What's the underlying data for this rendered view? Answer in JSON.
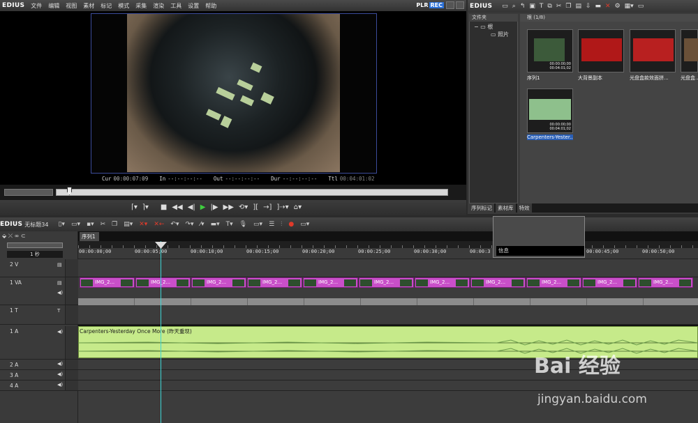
{
  "app": {
    "logo": "EDIUS",
    "plr": "PLR",
    "rec": "REC"
  },
  "menu": [
    "文件",
    "编辑",
    "视图",
    "素材",
    "标记",
    "模式",
    "采集",
    "渲染",
    "工具",
    "设置",
    "帮助"
  ],
  "preview": {
    "cur_label": "Cur",
    "cur": "00:00:07:09",
    "in_label": "In",
    "in": "--:--:--:--",
    "out_label": "Out",
    "out": "--:--:--:--",
    "dur_label": "Dur",
    "dur": "--:--:--:--",
    "ttl_label": "Ttl",
    "ttl": "00:04:01:02"
  },
  "bin": {
    "logo": "EDIUS",
    "folder_header": "文件夹",
    "folders": [
      "根",
      "照片"
    ],
    "clip_header": "根 (1/8)",
    "clips": [
      {
        "name": "序列1",
        "tc1": "00:00:00;00",
        "tc2": "00:04:01;02",
        "type": "sequence",
        "thumb": "#3c5a3a"
      },
      {
        "name": "大背景副本",
        "tc1": "",
        "tc2": "",
        "type": "image",
        "thumb": "#b01818"
      },
      {
        "name": "光盘盒款效面拼...",
        "tc1": "",
        "tc2": "",
        "type": "image",
        "thumb": "#b82020"
      },
      {
        "name": "光盘盒...",
        "tc1": "",
        "tc2": "",
        "type": "image",
        "thumb": "#6a5038"
      },
      {
        "name": "Carpenters-Yester...",
        "tc1": "00:00:00;00",
        "tc2": "00:04:01;02",
        "type": "audio",
        "thumb": "#8ec08c"
      }
    ],
    "tabs": [
      "序列标记",
      "素材库",
      "特效"
    ]
  },
  "timeline": {
    "project_name": "无标题34",
    "sequence_tab": "序列1",
    "info_label": "信息",
    "scale_label": "1 秒",
    "ruler": [
      "00:00:00;00",
      "00:00:05;00",
      "00:00:10;00",
      "00:00:15;00",
      "00:00:20;00",
      "00:00:25;00",
      "00:00:30;00",
      "00:00:3",
      "00:00:45;00",
      "00:00:50;00"
    ],
    "tracks": {
      "v2": "2 V",
      "va1": "1 VA",
      "t1": "1 T",
      "a1": "1 A",
      "a2": "2 A",
      "a3": "3 A",
      "a4": "4 A"
    },
    "va_clip_label": "IMG_2...",
    "audio_clip_title": "Carpenters-Yesterday Once More (昨天重现)"
  },
  "watermark": {
    "text": "Bai 经验",
    "url": "jingyan.baidu.com"
  }
}
